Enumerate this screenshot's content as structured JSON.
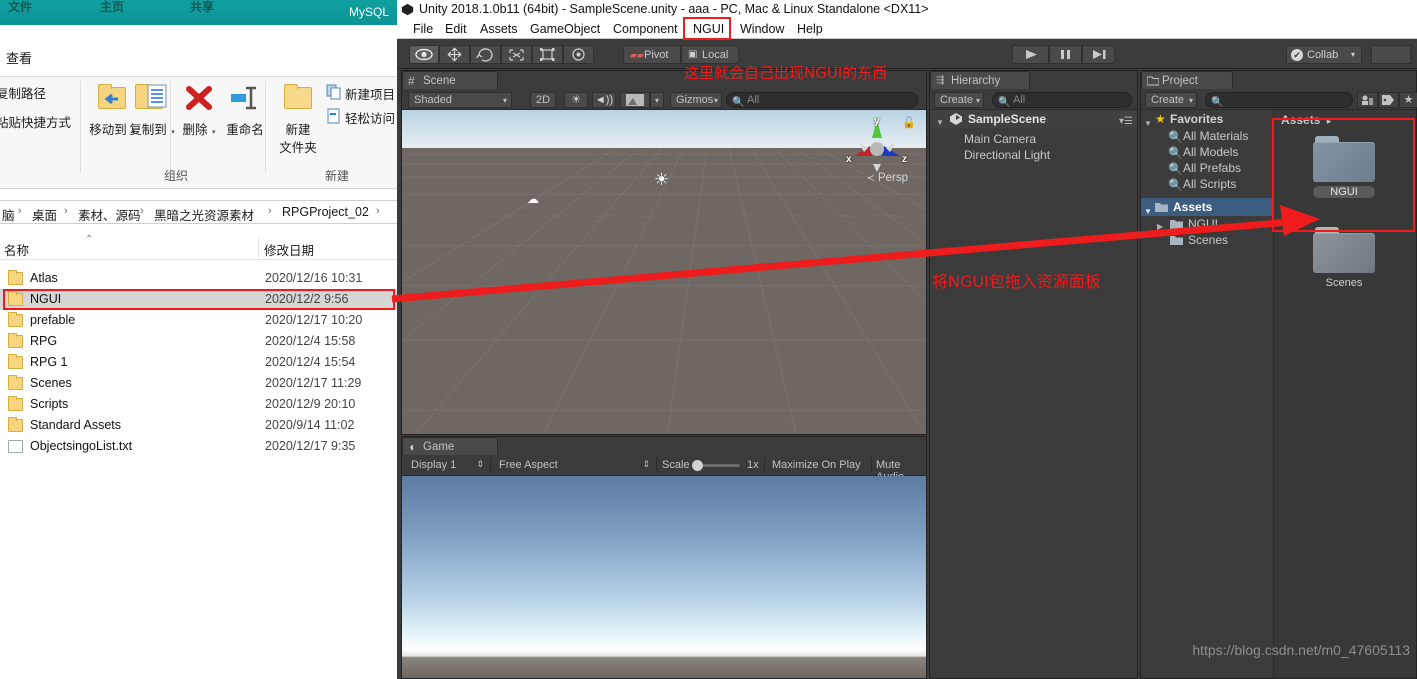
{
  "explorer": {
    "mysql_label": "MySQL",
    "teal_ghost": [
      "文件",
      "主页",
      "共享"
    ],
    "menu": [
      "查看"
    ],
    "ribbon": {
      "left_commands": [
        "复制路径",
        "粘贴快捷方式"
      ],
      "items": [
        {
          "label": "移动到",
          "icon": "move-to-icon",
          "caret": "▾"
        },
        {
          "label": "复制到",
          "icon": "copy-to-icon",
          "caret": "▾"
        },
        {
          "label": "删除",
          "icon": "delete-icon",
          "caret": "▾"
        },
        {
          "label": "重命名",
          "icon": "rename-icon",
          "caret": ""
        },
        {
          "label": "新建\n文件夹",
          "icon": "new-folder-icon",
          "caret": ""
        }
      ],
      "new_items": [
        {
          "label": "新建项目",
          "icon": "new-item-icon"
        },
        {
          "label": "轻松访问",
          "icon": "easy-access-icon"
        }
      ],
      "group_organize": "组织",
      "group_new": "新建"
    },
    "breadcrumb": [
      "脑",
      "桌面",
      "素材、源码",
      "黑暗之光资源素材",
      "RPGProject_02"
    ],
    "columns": {
      "name": "名称",
      "date": "修改日期"
    },
    "files": [
      {
        "name": "Atlas",
        "date": "2020/12/16 10:31",
        "type": "folder",
        "selected": false
      },
      {
        "name": "NGUI",
        "date": "2020/12/2 9:56",
        "type": "folder",
        "selected": true
      },
      {
        "name": "prefable",
        "date": "2020/12/17 10:20",
        "type": "folder",
        "selected": false
      },
      {
        "name": "RPG",
        "date": "2020/12/4 15:58",
        "type": "folder",
        "selected": false
      },
      {
        "name": "RPG 1",
        "date": "2020/12/4 15:54",
        "type": "folder",
        "selected": false
      },
      {
        "name": "Scenes",
        "date": "2020/12/17 11:29",
        "type": "folder",
        "selected": false
      },
      {
        "name": "Scripts",
        "date": "2020/12/9 20:10",
        "type": "folder",
        "selected": false
      },
      {
        "name": "Standard Assets",
        "date": "2020/9/14 11:02",
        "type": "folder",
        "selected": false
      },
      {
        "name": "ObjectsingoList.txt",
        "date": "2020/12/17 9:35",
        "type": "file",
        "selected": false
      }
    ]
  },
  "unity": {
    "title": "Unity 2018.1.0b11 (64bit) - SampleScene.unity - aaa - PC, Mac & Linux Standalone <DX11>",
    "menu": [
      "File",
      "Edit",
      "Assets",
      "GameObject",
      "Component",
      "NGUI",
      "Window",
      "Help"
    ],
    "highlighted_menu": "NGUI",
    "toolbar": {
      "tools": [
        "hand-tool",
        "move-tool",
        "rotate-tool",
        "scale-tool",
        "rect-tool",
        "transform-tool"
      ],
      "pivot": "Pivot",
      "local": "Local",
      "play": "▶",
      "pause": "❙❙",
      "step": "▶❙",
      "collab": "Collab",
      "collab_caret": "▾"
    },
    "scene_panel": {
      "tab": "Scene",
      "shading": "Shaded",
      "mode_2d": "2D",
      "lighting_icon": "sun-icon",
      "audio_icon": "speaker-icon",
      "effects_icon": "image-icon",
      "gizmos": "Gizmos",
      "search_placeholder": "All",
      "gizmo_axes": [
        "x",
        "y",
        "z"
      ],
      "projection": "Persp"
    },
    "game_panel": {
      "tab": "Game",
      "display": "Display 1",
      "aspect": "Free Aspect",
      "scale_label": "Scale",
      "scale_value": "1x",
      "maximize": "Maximize On Play",
      "mute": "Mute Audio"
    },
    "hierarchy_panel": {
      "tab": "Hierarchy",
      "create": "Create",
      "create_caret": "▾",
      "search_placeholder": "All",
      "items": [
        {
          "label": "SampleScene",
          "depth": 0,
          "icon": "unity-scene-icon",
          "expanded": true
        },
        {
          "label": "Main Camera",
          "depth": 1,
          "icon": "",
          "expanded": false
        },
        {
          "label": "Directional Light",
          "depth": 1,
          "icon": "",
          "expanded": false
        }
      ]
    },
    "project_panel": {
      "tab": "Project",
      "create": "Create",
      "create_caret": "▾",
      "search_placeholder": "",
      "tree": [
        {
          "label": "Favorites",
          "depth": 0,
          "icon": "star-icon",
          "expanded": true,
          "selected": false
        },
        {
          "label": "All Materials",
          "depth": 1,
          "icon": "search-icon",
          "expanded": false,
          "selected": false
        },
        {
          "label": "All Models",
          "depth": 1,
          "icon": "search-icon",
          "expanded": false,
          "selected": false
        },
        {
          "label": "All Prefabs",
          "depth": 1,
          "icon": "search-icon",
          "expanded": false,
          "selected": false
        },
        {
          "label": "All Scripts",
          "depth": 1,
          "icon": "search-icon",
          "expanded": false,
          "selected": false
        },
        {
          "label": "Assets",
          "depth": 0,
          "icon": "folder-icon",
          "expanded": true,
          "selected": true
        },
        {
          "label": "NGUI",
          "depth": 1,
          "icon": "folder-icon",
          "expanded": false,
          "selected": false
        },
        {
          "label": "Scenes",
          "depth": 1,
          "icon": "folder-icon",
          "expanded": false,
          "selected": false
        }
      ],
      "breadcrumb": "Assets",
      "breadcrumb_caret": "▸",
      "assets": [
        {
          "label": "NGUI",
          "selected": true
        },
        {
          "label": "Scenes",
          "selected": false
        }
      ]
    },
    "watermark": "https://blog.csdn.net/m0_47605113"
  },
  "annotations": [
    {
      "id": "anno-menu",
      "text": "这里就会自己出现NGUI的东西"
    },
    {
      "id": "anno-drag",
      "text": "将NGUI包拖入资源面板"
    }
  ],
  "colors": {
    "accent_red": "#ee1c1c",
    "unity_bg": "#3b3b3b",
    "selection_blue": "#3d5d80",
    "teal": "#0f9b9b",
    "folder_yellow": "#f6d480"
  }
}
